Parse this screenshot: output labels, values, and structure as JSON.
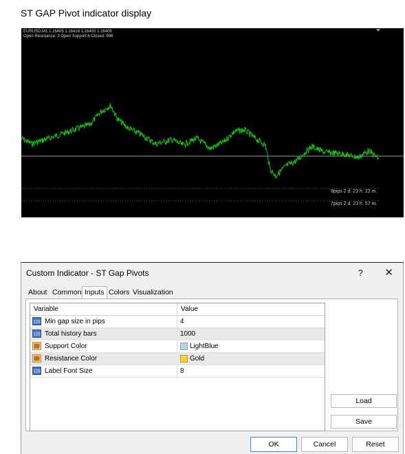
{
  "page_heading": "ST GAP Pivot indicator display",
  "chart": {
    "info_line1": "EURUSD,M1  1.16405 1.16418 1.16405 1.16409",
    "info_line2": "Open Resistance: 3 Open Support:6 Closed: 996",
    "gap_label_1": "9pips 2 d. 23 h. 22 m.",
    "gap_label_2": "7pips 2 d. 23 h. 57 m.",
    "colors": {
      "background": "#000000",
      "price_line": "#00e000",
      "level_line": "#cfcfcf"
    }
  },
  "dialog": {
    "title": "Custom Indicator - ST  Gap Pivots",
    "help": "?",
    "close": "✕",
    "tabs": [
      "About",
      "Common",
      "Inputs",
      "Colors",
      "Visualization"
    ],
    "active_tab": "Inputs",
    "grid": {
      "headers": {
        "variable": "Variable",
        "value": "Value"
      },
      "rows": [
        {
          "icon": "numeric-icon",
          "variable": "Min gap size in pips",
          "value": "4"
        },
        {
          "icon": "numeric-icon",
          "variable": "Total history bars",
          "value": "1000"
        },
        {
          "icon": "color-icon",
          "variable": "Support Color",
          "value": "LightBlue",
          "swatch": "#add8e6"
        },
        {
          "icon": "color-icon",
          "variable": "Resistance Color",
          "value": "Gold",
          "swatch": "#ffd700"
        },
        {
          "icon": "numeric-icon",
          "variable": "Label Font Size",
          "value": "8"
        }
      ]
    },
    "buttons": {
      "load": "Load",
      "save": "Save",
      "ok": "OK",
      "cancel": "Cancel",
      "reset": "Reset"
    }
  }
}
